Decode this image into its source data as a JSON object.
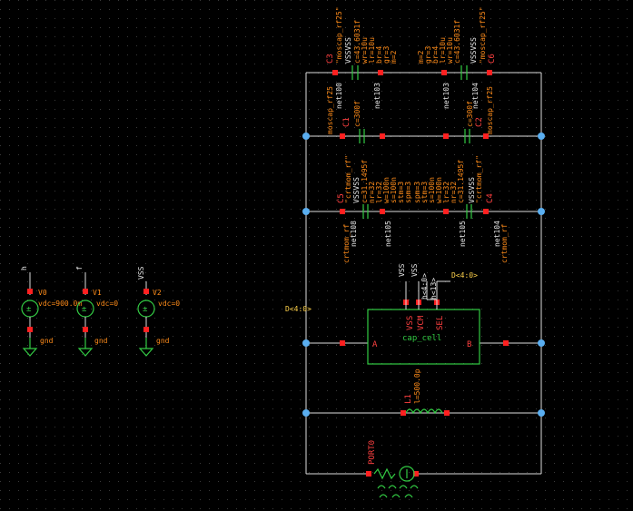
{
  "colors": {
    "background": "#000000",
    "wire": "#dcdcdc",
    "component": "#33cc44",
    "pin": "#ff2020",
    "node": "#5aaef0",
    "instance_label": "#ff8c1a",
    "net_label": "#ffd24a"
  },
  "sources": [
    {
      "net": "h",
      "inst": "V0",
      "param": "vdc=900.0m",
      "gnd": "gnd"
    },
    {
      "net": "f",
      "inst": "V1",
      "param": "vdc=0",
      "gnd": "gnd"
    },
    {
      "net": "VSS",
      "inst": "V2",
      "param": "vdc=0",
      "gnd": "gnd"
    }
  ],
  "moscap_left": {
    "inst": "C3",
    "model": "\"moscap_rf25\"",
    "pins": "VSSVSS",
    "params": [
      "c=43.6031f",
      "wr=10u",
      "lr=10u",
      "br=4",
      "gr=3",
      "m=2"
    ]
  },
  "moscap_right": {
    "inst": "C6",
    "model": "\"moscap_rf25\"",
    "pins": "VSSVSS",
    "params": [
      "c=43.6031f",
      "wr=10u",
      "lr=10u",
      "br=4",
      "gr=3",
      "m=2"
    ]
  },
  "moscap_nets": [
    "net100",
    "net103",
    "net103",
    "net104"
  ],
  "cap_mid_left": {
    "inst": "C1",
    "param": "c=300f",
    "model": "moscap_rf25"
  },
  "cap_mid_right": {
    "inst": "C2",
    "param": "c=300f",
    "model": "moscap_rf25"
  },
  "cap_low_left": {
    "inst": "C5",
    "model": "\"crtmom_rf\"",
    "pins": "VSSVSS",
    "params": [
      "c=31.1495f",
      "nr=32",
      "lr=32",
      "w=100n",
      "s=100n",
      "stm=3",
      "spm=3"
    ]
  },
  "cap_low_right": {
    "inst": "C4",
    "model": "\"crtmom_rf\"",
    "pins": "VSSVSS",
    "params": [
      "c=31.1495f",
      "nr=32",
      "lr=32",
      "w=100n",
      "s=100n",
      "stm=3",
      "spm=3"
    ]
  },
  "cap_low_nets": [
    "crtmom_rf",
    "net108",
    "net105",
    "net105",
    "net104",
    "crtmom_rf"
  ],
  "cell": {
    "name": "cap_cell",
    "pin_a": "A",
    "pin_b": "B",
    "pins_top": [
      "VSS",
      "VCM",
      "SEL"
    ],
    "top_nets": [
      "VSS",
      "VSS",
      "h<4:0>",
      "h<13>"
    ],
    "bus_label": "D<4:0>",
    "left_bus": "D<4:0>"
  },
  "inductor": {
    "inst": "L1",
    "param": "l=500.0p"
  },
  "port": {
    "inst": "PORT0"
  }
}
